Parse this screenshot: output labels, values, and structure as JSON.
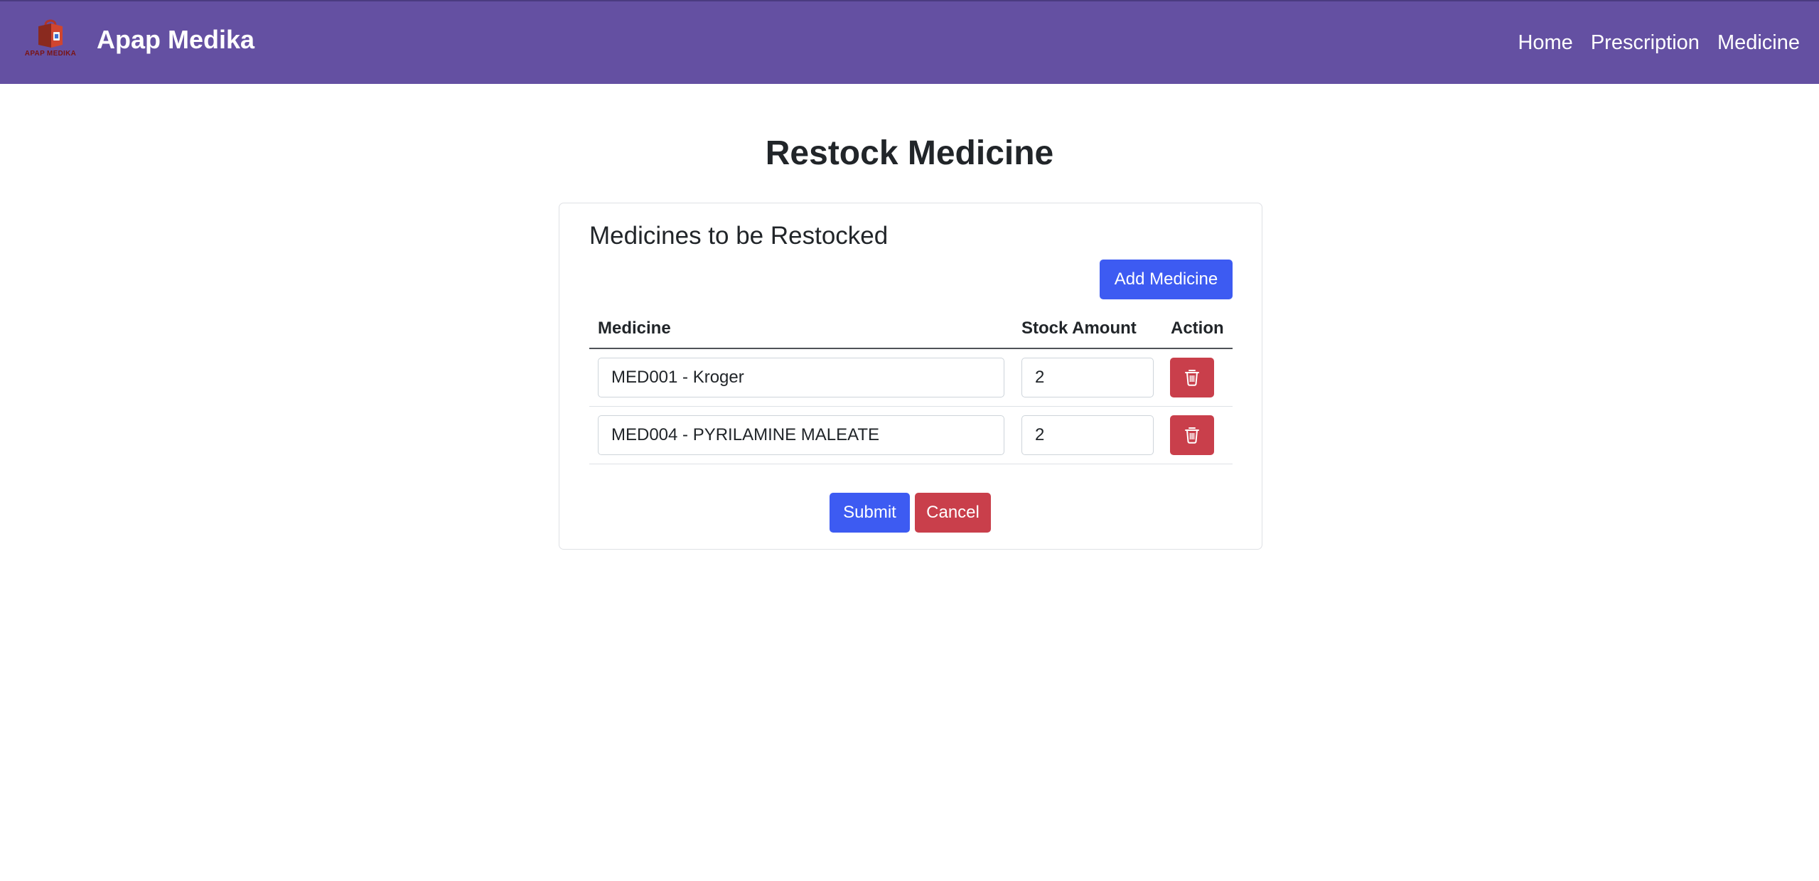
{
  "navbar": {
    "logo_text": "APAP MEDIKA",
    "brand": "Apap Medika",
    "links": [
      "Home",
      "Prescription",
      "Medicine"
    ],
    "color": "#6450a2"
  },
  "page": {
    "title": "Restock Medicine"
  },
  "card": {
    "title": "Medicines to be Restocked",
    "add_button": "Add Medicine",
    "table": {
      "headers": [
        "Medicine",
        "Stock Amount",
        "Action"
      ],
      "rows": [
        {
          "medicine": "MED001 - Kroger",
          "stock": "2",
          "action_icon": "trash-icon"
        },
        {
          "medicine": "MED004 - PYRILAMINE MALEATE",
          "stock": "2",
          "action_icon": "trash-icon"
        }
      ]
    },
    "submit_button": "Submit",
    "cancel_button": "Cancel"
  },
  "colors": {
    "primary": "#3d5bf2",
    "danger": "#c93f4b"
  }
}
